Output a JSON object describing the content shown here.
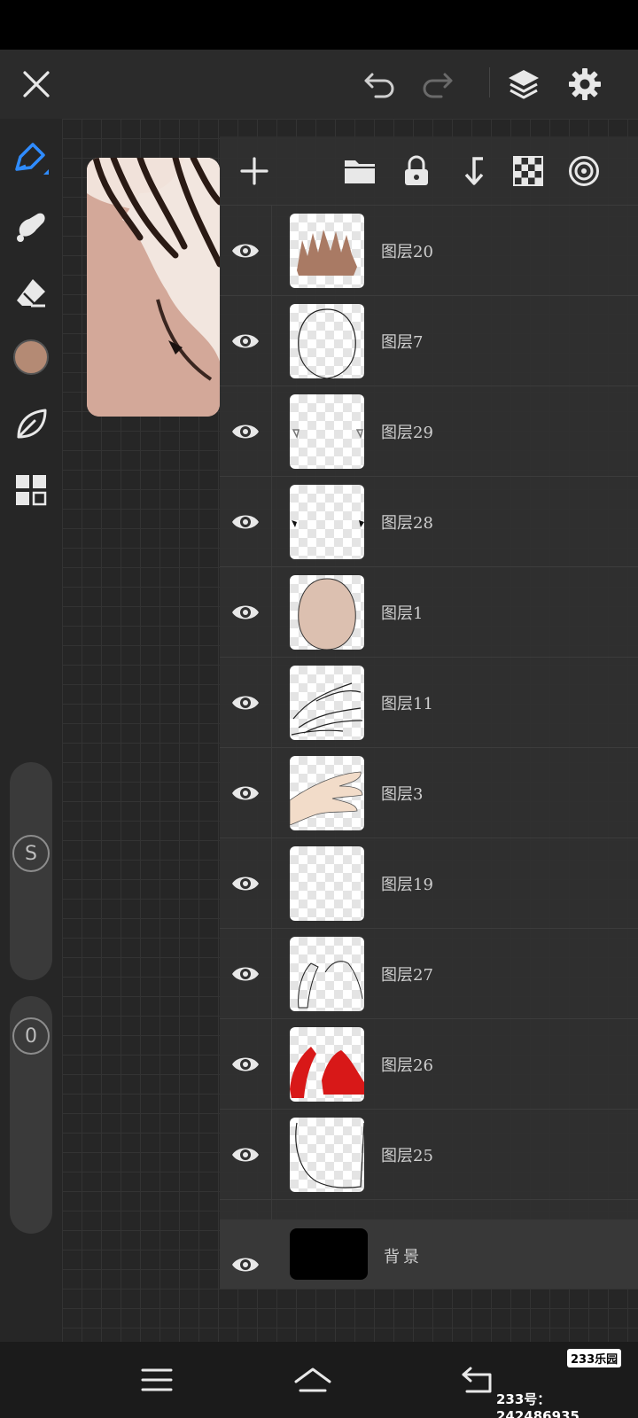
{
  "icons": {
    "close": "close-icon",
    "undo": "undo-icon",
    "redo": "redo-icon",
    "layers": "layers-icon",
    "settings": "gear-icon",
    "brush": "brush-icon",
    "smudge": "smudge-icon",
    "eraser": "eraser-icon",
    "leaf": "leaf-icon",
    "grid": "grid-icon"
  },
  "colors": {
    "current_color": "#b48a74",
    "brush_active": "#2f8cff"
  },
  "left_toolbar": {
    "size_slider_label": "S",
    "opacity_slider_label": "0"
  },
  "layers_panel": {
    "header_icons": [
      "plus-icon",
      "folder-icon",
      "lock-icon",
      "merge-down-icon",
      "transparency-icon",
      "target-icon"
    ],
    "layers": [
      {
        "name": "图层20",
        "visible": true,
        "thumb": "hair"
      },
      {
        "name": "图层7",
        "visible": true,
        "thumb": "face-outline"
      },
      {
        "name": "图层29",
        "visible": true,
        "thumb": "marks-light"
      },
      {
        "name": "图层28",
        "visible": true,
        "thumb": "marks-dark"
      },
      {
        "name": "图层1",
        "visible": true,
        "thumb": "face-fill"
      },
      {
        "name": "图层11",
        "visible": true,
        "thumb": "hand-outline"
      },
      {
        "name": "图层3",
        "visible": true,
        "thumb": "hand-fill"
      },
      {
        "name": "图层19",
        "visible": true,
        "thumb": "empty"
      },
      {
        "name": "图层27",
        "visible": true,
        "thumb": "sleeves-outline"
      },
      {
        "name": "图层26",
        "visible": true,
        "thumb": "sleeves-red"
      },
      {
        "name": "图层25",
        "visible": true,
        "thumb": "body-outline"
      }
    ],
    "background_layer": {
      "name": "背景",
      "visible": true
    }
  },
  "watermark": {
    "badge": "233乐园",
    "text": "233号： 242486935"
  }
}
